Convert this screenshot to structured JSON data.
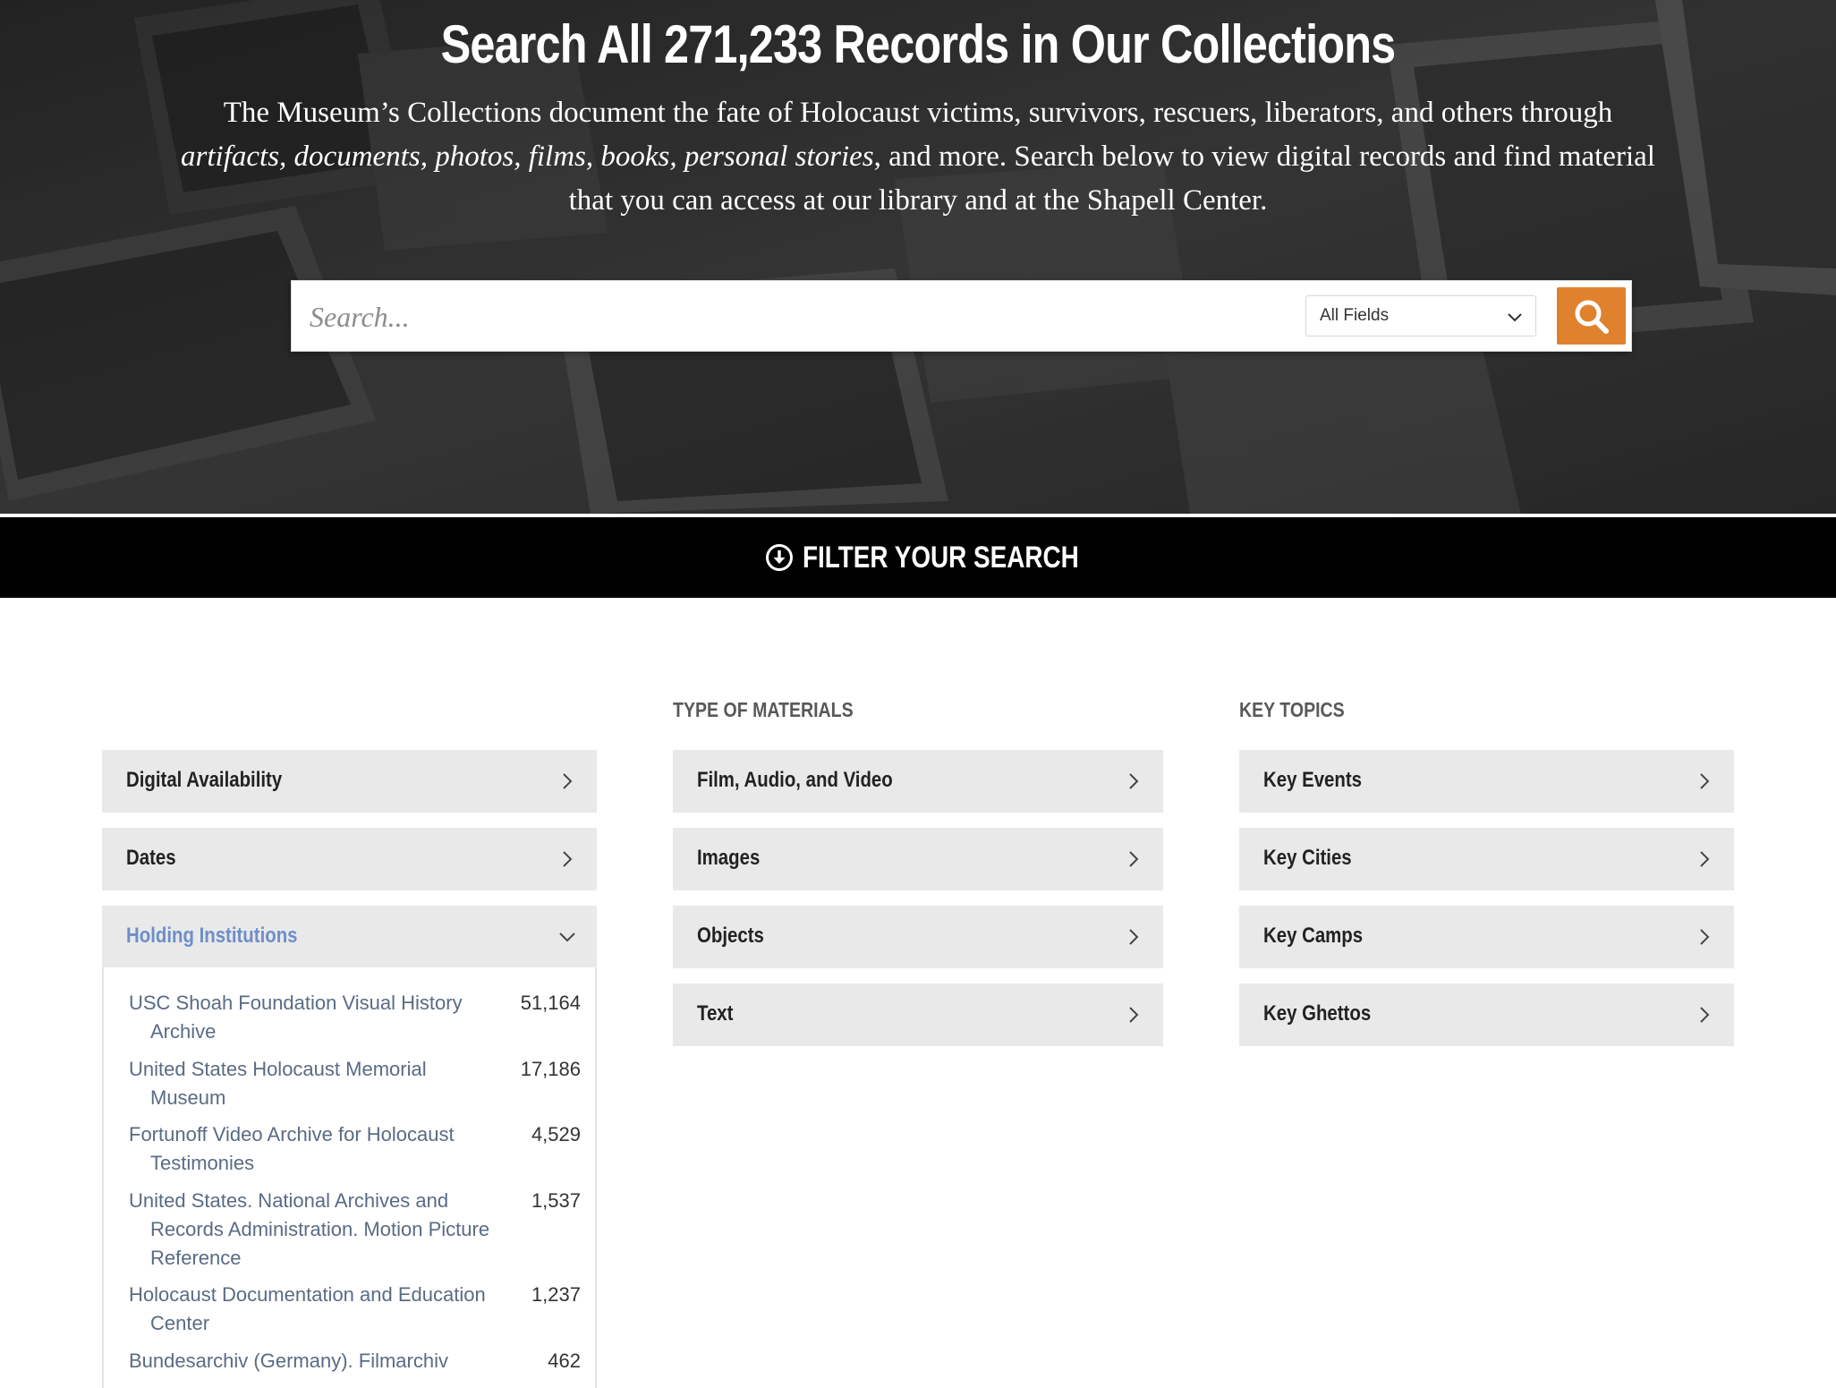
{
  "hero": {
    "title": "Search All 271,233 Records in Our Collections",
    "description_line1": "The Museum’s Collections document the fate of Holocaust victims, survivors, rescuers, liberators, and others through",
    "description_italic": "artifacts, documents, photos, films, books, personal stories",
    "description_line2_rest": ", and more. Search below to view digital records and find material",
    "description_line3": "that you can access at our library and at the Shapell Center."
  },
  "search": {
    "placeholder": "Search...",
    "field_selected": "All Fields",
    "button_icon": "search-icon",
    "button_color": "#e0812e"
  },
  "filter_bar": {
    "label": "FILTER YOUR SEARCH",
    "icon": "arrow-down-circle-icon"
  },
  "columns": {
    "general": {
      "facets": [
        {
          "label": "Digital Availability",
          "state": "collapsed"
        },
        {
          "label": "Dates",
          "state": "collapsed"
        },
        {
          "label": "Holding Institutions",
          "state": "expanded"
        }
      ],
      "holding_institutions": [
        {
          "name": "USC Shoah Foundation Visual History Archive",
          "count": "51,164"
        },
        {
          "name": "United States Holocaust Memorial Museum",
          "count": "17,186"
        },
        {
          "name": "Fortunoff Video Archive for Holocaust Testimonies",
          "count": "4,529"
        },
        {
          "name": "United States. National Archives and Records Administration. Motion Picture Reference",
          "count": "1,537"
        },
        {
          "name": "Holocaust Documentation and Education Center",
          "count": "1,237"
        },
        {
          "name": "Bundesarchiv (Germany). Filmarchiv",
          "count": "462"
        }
      ]
    },
    "materials": {
      "heading": "TYPE OF MATERIALS",
      "facets": [
        {
          "label": "Film, Audio, and Video"
        },
        {
          "label": "Images"
        },
        {
          "label": "Objects"
        },
        {
          "label": "Text"
        }
      ]
    },
    "topics": {
      "heading": "KEY TOPICS",
      "facets": [
        {
          "label": "Key Events"
        },
        {
          "label": "Key Cities"
        },
        {
          "label": "Key Camps"
        },
        {
          "label": "Key Ghettos"
        }
      ]
    }
  },
  "colors": {
    "accent": "#e0812e",
    "active_facet": "#6e8ec9",
    "facet_bg": "#e9e9e9",
    "link_text": "#5a6b84"
  }
}
